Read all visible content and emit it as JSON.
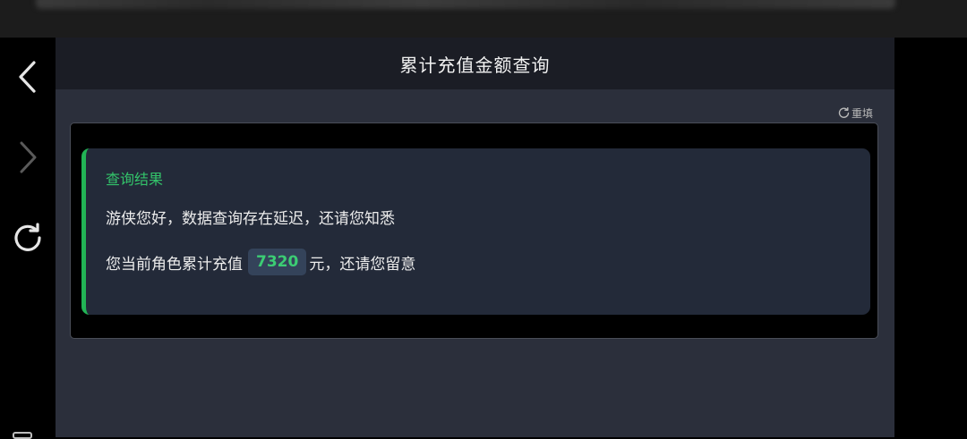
{
  "window": {
    "title": "累计充值金额查询"
  },
  "nav": {
    "back_icon": "chevron-left-icon",
    "forward_icon": "chevron-right-icon",
    "refresh_icon": "refresh-icon"
  },
  "form": {
    "reset_label": "重填",
    "reset_icon": "refresh-icon"
  },
  "result": {
    "heading": "查询结果",
    "greeting": "游侠您好，数据查询存在延迟，还请您知悉",
    "prefix": "您当前角色累计充值",
    "amount": "7320",
    "suffix": "元，还请您留意"
  },
  "colors": {
    "accent_green": "#22b455",
    "amount_green": "#3ccd74",
    "panel_bg": "#2b2f3b",
    "header_bg": "#1b1d25",
    "card_bg": "#232a39"
  }
}
